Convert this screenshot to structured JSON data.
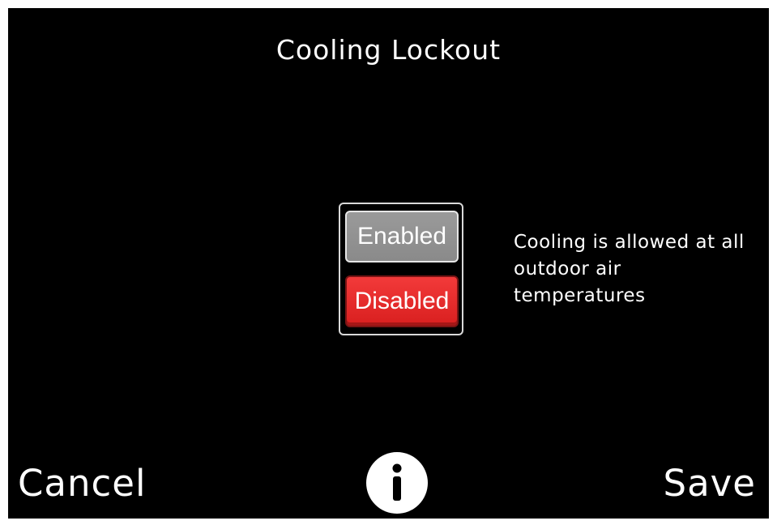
{
  "header": {
    "title": "Cooling Lockout"
  },
  "toggle": {
    "options": [
      {
        "label": "Enabled",
        "selected": false
      },
      {
        "label": "Disabled",
        "selected": true
      }
    ]
  },
  "description": {
    "text": "Cooling is allowed at all outdoor air temperatures"
  },
  "footer": {
    "cancel_label": "Cancel",
    "save_label": "Save",
    "info_icon": "info-icon"
  },
  "colors": {
    "background": "#000000",
    "selected": "#e52626",
    "unselected": "#8f8f8f",
    "text": "#ffffff"
  }
}
